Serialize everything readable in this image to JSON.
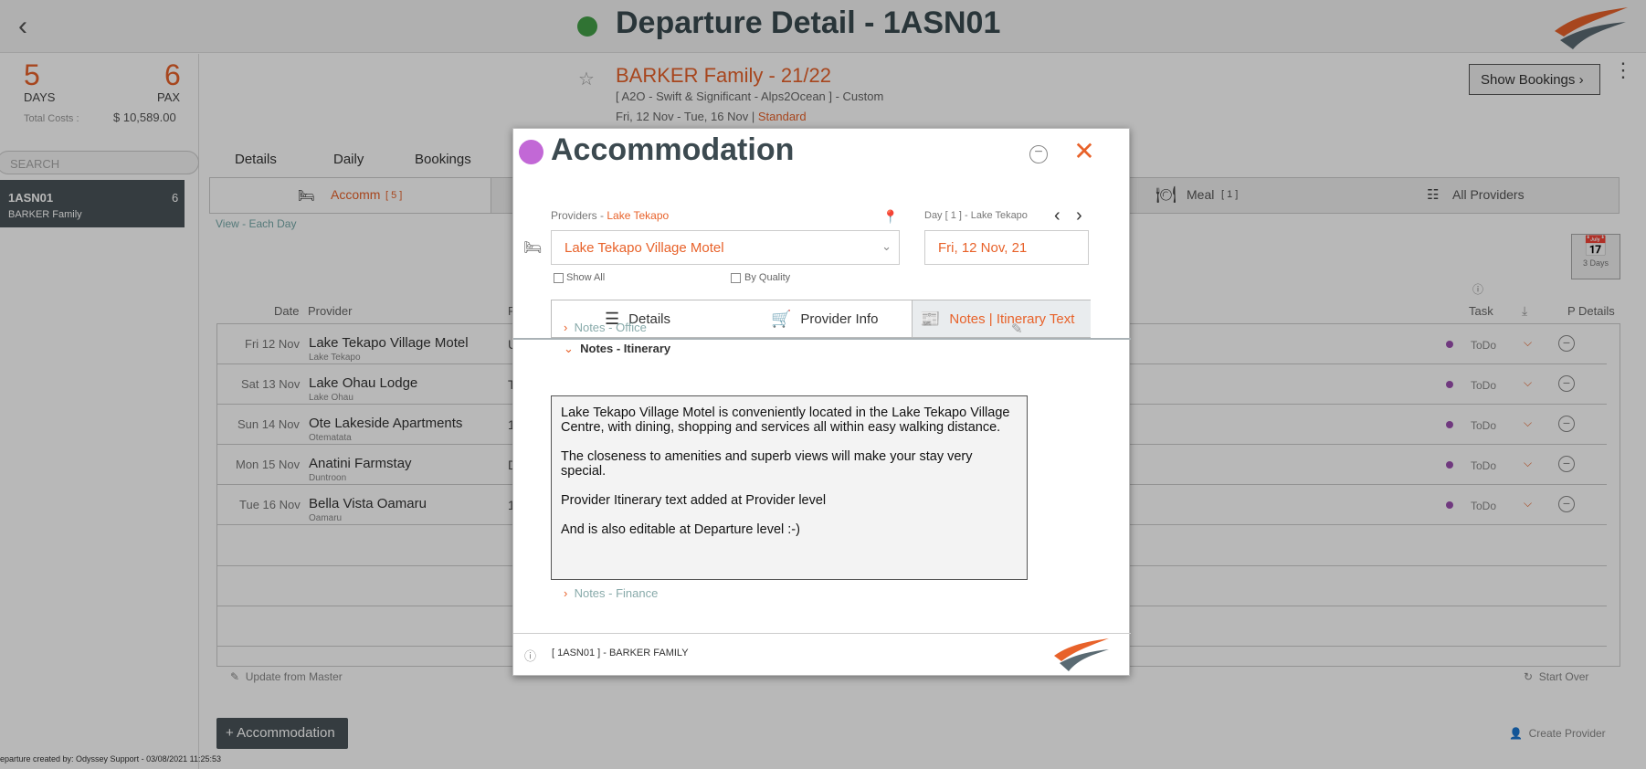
{
  "header": {
    "title": "Departure Detail - 1ASN01"
  },
  "summary": {
    "days_value": "5",
    "days_label": "DAYS",
    "pax_value": "6",
    "pax_label": "PAX",
    "total_costs_label": "Total Costs :",
    "total_costs_value": "$ 10,589.00"
  },
  "search": {
    "placeholder": "SEARCH"
  },
  "departure_list": [
    {
      "code": "1ASN01",
      "count": "6",
      "name": "BARKER Family"
    }
  ],
  "departure": {
    "name": "BARKER Family - 21/22",
    "package": "[ A2O - Swift & Significant - Alps2Ocean ] - Custom",
    "dates": "Fri, 12 Nov  - Tue, 16 Nov  |",
    "tier": "Standard"
  },
  "show_bookings_label": "Show Bookings",
  "tabs": [
    "Details",
    "Daily",
    "Bookings"
  ],
  "category_tabs": {
    "accomm_label": "Accomm",
    "accomm_count": "[ 5 ]",
    "meal_label": "Meal",
    "meal_count": "[ 1 ]",
    "all_providers_label": "All Providers"
  },
  "view_each_day": "View - Each Day",
  "calendar_days": "3 Days",
  "table": {
    "headers": {
      "date": "Date",
      "provider": "Provider",
      "p": "P",
      "task": "Task",
      "p_details": "P Details"
    },
    "rows": [
      {
        "date": "Fri 12 Nov",
        "provider": "Lake Tekapo Village Motel",
        "location": "Lake Tekapo",
        "col": "U",
        "task": "ToDo"
      },
      {
        "date": "Sat 13 Nov",
        "provider": "Lake Ohau Lodge",
        "location": "Lake Ohau",
        "col": "T",
        "task": "ToDo"
      },
      {
        "date": "Sun 14 Nov",
        "provider": "Ote Lakeside Apartments",
        "location": "Otematata",
        "col": "1",
        "task": "ToDo"
      },
      {
        "date": "Mon 15 Nov",
        "provider": "Anatini Farmstay",
        "location": "Duntroon",
        "col": "D",
        "task": "ToDo"
      },
      {
        "date": "Tue 16 Nov",
        "provider": "Bella Vista Oamaru",
        "location": "Oamaru",
        "col": "1",
        "task": "ToDo"
      }
    ]
  },
  "update_from_master": "Update from Master",
  "start_over": "Start Over",
  "add_accommodation": "Accommodation",
  "create_provider": "Create Provider",
  "created_by": "eparture created by: Odyssey Support - 03/08/2021 11:25:53",
  "modal": {
    "title": "Accommodation",
    "providers_label": "Providers -",
    "providers_location": "Lake Tekapo",
    "day_label": "Day [ 1 ] - Lake Tekapo",
    "provider_selected": "Lake Tekapo Village Motel",
    "date_value": "Fri, 12 Nov, 21",
    "show_all_label": "Show All",
    "by_quality_label": "By Quality",
    "tab_details": "Details",
    "tab_provider_info": "Provider Info",
    "tab_notes": "Notes | Itinerary Text",
    "notes_office": "Notes - Office",
    "notes_itinerary": "Notes - Itinerary",
    "notes_finance": "Notes - Finance",
    "itinerary_text": "Lake Tekapo Village Motel is conveniently located in the Lake Tekapo Village Centre, with dining, shopping and services all within easy walking distance.\n\nThe closeness to amenities and superb views will make your stay very special.\n\nProvider Itinerary text added at Provider level\n\nAnd is also editable at Departure level :-)",
    "footer_text": "[ 1ASN01 ] - BARKER FAMILY"
  },
  "colors": {
    "accent": "#e8622a",
    "status_green": "#43a047",
    "modal_dot": "#c268d6",
    "todo_dot": "#9c4fb0"
  }
}
